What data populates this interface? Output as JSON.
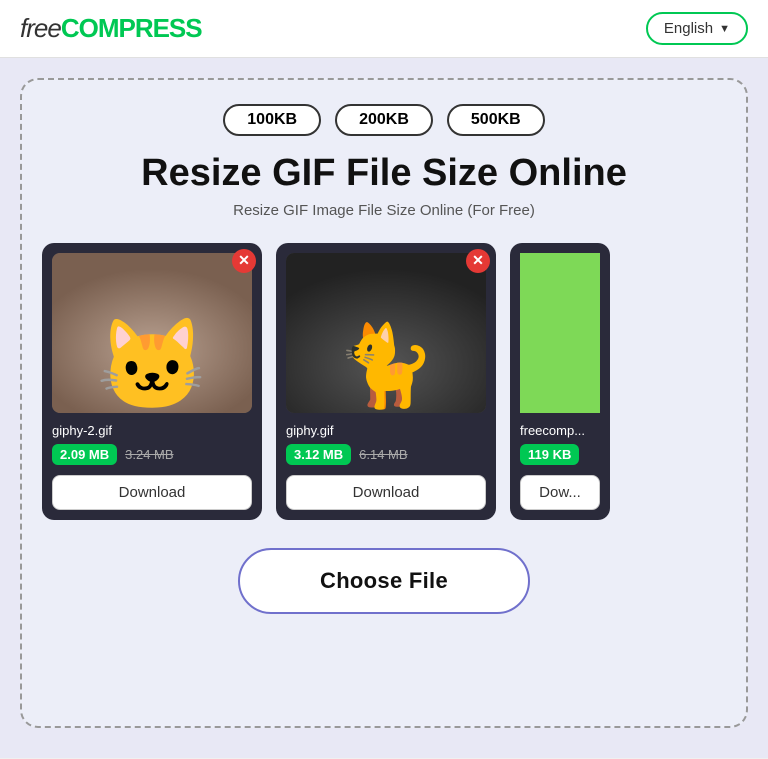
{
  "header": {
    "logo_free": "free",
    "logo_compress": "COMPRESS",
    "language_label": "English",
    "language_chevron": "▼"
  },
  "main": {
    "pills": [
      "100KB",
      "200KB",
      "500KB"
    ],
    "title": "Resize GIF File Size Online",
    "subtitle": "Resize GIF Image File Size Online (For Free)",
    "cards": [
      {
        "filename": "giphy-2.gif",
        "size_new": "2.09 MB",
        "size_old": "3.24 MB",
        "download_label": "Download"
      },
      {
        "filename": "giphy.gif",
        "size_new": "3.12 MB",
        "size_old": "6.14 MB",
        "download_label": "Download"
      },
      {
        "filename": "freecomp...",
        "size_new": "119 KB",
        "size_old": "",
        "download_label": "Dow..."
      }
    ],
    "choose_file_label": "Choose File"
  }
}
